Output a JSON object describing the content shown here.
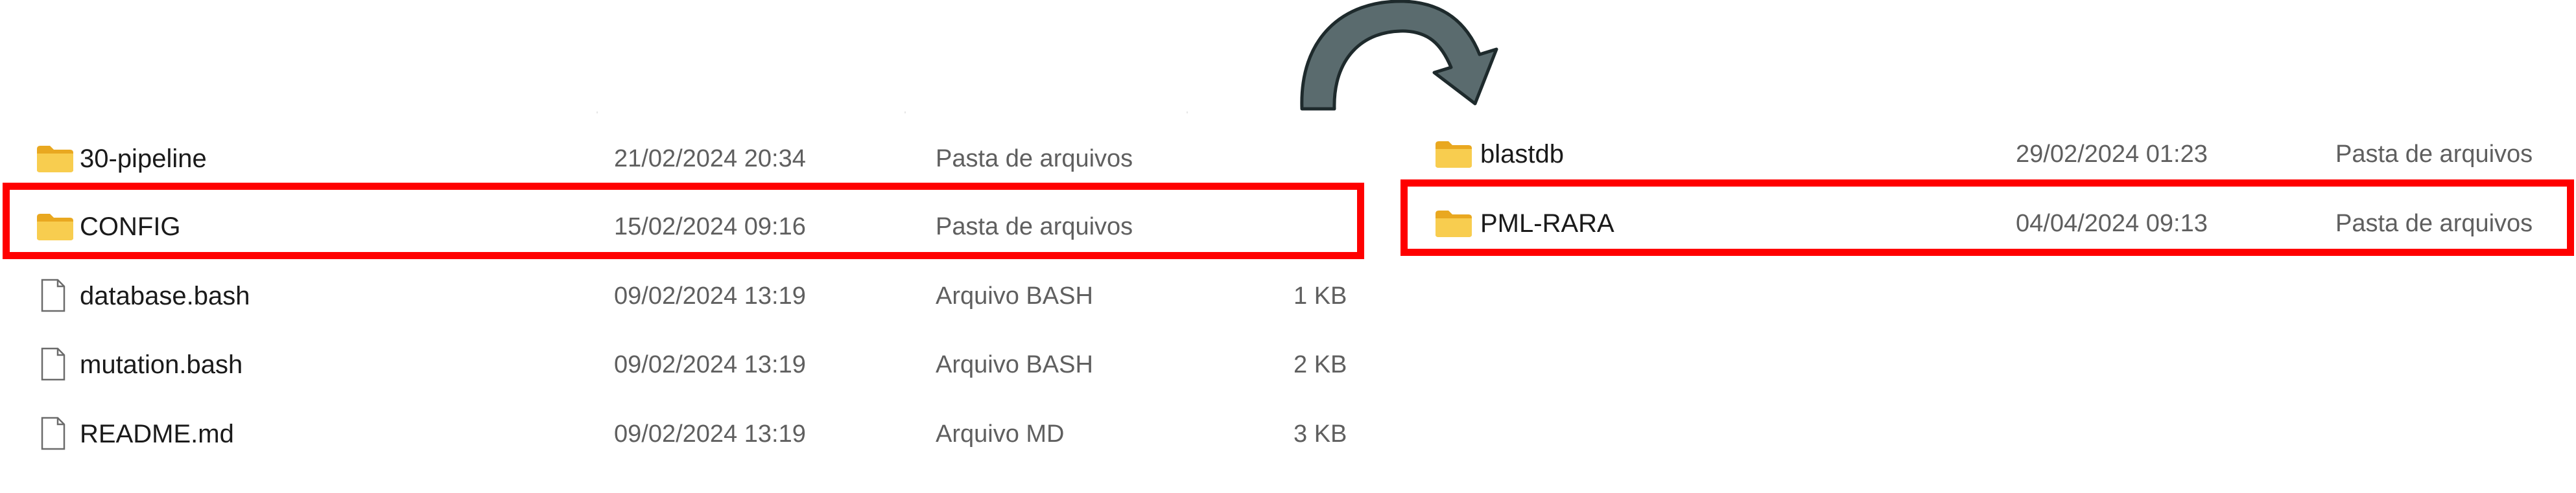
{
  "left_pane": {
    "items": [
      {
        "name": "30-pipeline",
        "date": "21/02/2024 20:34",
        "type": "Pasta de arquivos",
        "size": "",
        "kind": "folder"
      },
      {
        "name": "CONFIG",
        "date": "15/02/2024 09:16",
        "type": "Pasta de arquivos",
        "size": "",
        "kind": "folder",
        "highlighted": true
      },
      {
        "name": "database.bash",
        "date": "09/02/2024 13:19",
        "type": "Arquivo BASH",
        "size": "1 KB",
        "kind": "file"
      },
      {
        "name": "mutation.bash",
        "date": "09/02/2024 13:19",
        "type": "Arquivo BASH",
        "size": "2 KB",
        "kind": "file"
      },
      {
        "name": "README.md",
        "date": "09/02/2024 13:19",
        "type": "Arquivo MD",
        "size": "3 KB",
        "kind": "file"
      }
    ]
  },
  "right_pane": {
    "items": [
      {
        "name": "blastdb",
        "date": "29/02/2024 01:23",
        "type": "Pasta de arquivos",
        "kind": "folder"
      },
      {
        "name": "PML-RARA",
        "date": "04/04/2024 09:13",
        "type": "Pasta de arquivos",
        "kind": "folder",
        "highlighted": true
      }
    ]
  },
  "colors": {
    "highlight": "#ff0000",
    "folder": "#f3c33b",
    "arrow": "#5a6b6e"
  },
  "icons": {
    "folder": "folder-icon",
    "file": "file-icon",
    "arrow": "curved-arrow-icon"
  }
}
